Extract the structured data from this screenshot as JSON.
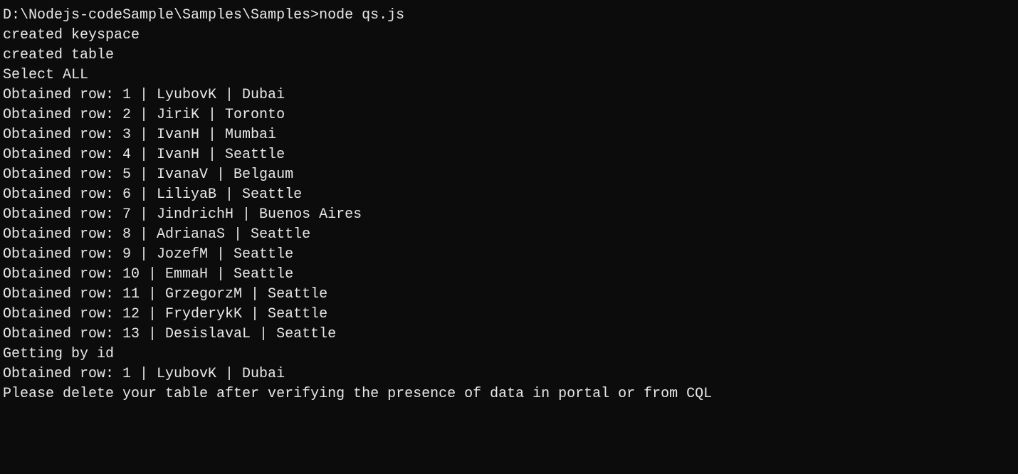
{
  "prompt": {
    "path": "D:\\Nodejs-codeSample\\Samples\\Samples>",
    "command": "node qs.js"
  },
  "output": {
    "lines": [
      "created keyspace",
      "created table",
      "Select ALL"
    ],
    "rows": [
      {
        "id": 1,
        "name": "LyubovK",
        "city": "Dubai"
      },
      {
        "id": 2,
        "name": "JiriK",
        "city": "Toronto"
      },
      {
        "id": 3,
        "name": "IvanH",
        "city": "Mumbai"
      },
      {
        "id": 4,
        "name": "IvanH",
        "city": "Seattle"
      },
      {
        "id": 5,
        "name": "IvanaV",
        "city": "Belgaum"
      },
      {
        "id": 6,
        "name": "LiliyaB",
        "city": "Seattle"
      },
      {
        "id": 7,
        "name": "JindrichH",
        "city": "Buenos Aires"
      },
      {
        "id": 8,
        "name": "AdrianaS",
        "city": "Seattle"
      },
      {
        "id": 9,
        "name": "JozefM",
        "city": "Seattle"
      },
      {
        "id": 10,
        "name": "EmmaH",
        "city": "Seattle"
      },
      {
        "id": 11,
        "name": "GrzegorzM",
        "city": "Seattle"
      },
      {
        "id": 12,
        "name": "FryderykK",
        "city": "Seattle"
      },
      {
        "id": 13,
        "name": "DesislavaL",
        "city": "Seattle"
      }
    ],
    "getting_by_id": "Getting by id",
    "by_id_row": {
      "id": 1,
      "name": "LyubovK",
      "city": "Dubai"
    },
    "final_message": "Please delete your table after verifying the presence of data in portal or from CQL"
  },
  "row_prefix": "Obtained row: "
}
